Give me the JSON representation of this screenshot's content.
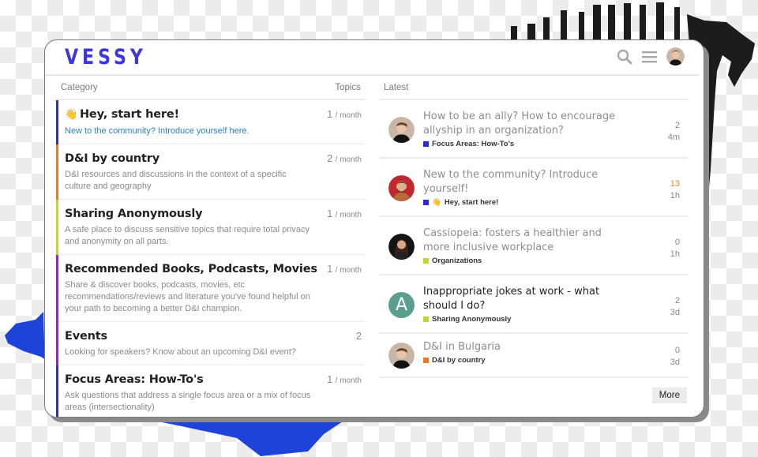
{
  "brand": {
    "logo": "VESSY",
    "accent": "#3d36d9"
  },
  "header": {
    "icons": [
      "search-icon",
      "hamburger-menu-icon",
      "user-avatar"
    ]
  },
  "categories": {
    "column_label": "Category",
    "topics_label": "Topics",
    "items": [
      {
        "emoji": "👋",
        "title": "Hey, start here!",
        "description": "New to the community? Introduce yourself here.",
        "count": "1",
        "period": "/ month",
        "color": "#2c2cd6",
        "desc_is_link": true
      },
      {
        "emoji": "",
        "title": "D&I by country",
        "description": "D&I resources and discussions in the context of a specific culture and geography",
        "count": "2",
        "period": "/ month",
        "color": "#f47620"
      },
      {
        "emoji": "",
        "title": "Sharing Anonymously",
        "description": "A safe place to discuss sensitive topics that require total privacy and anonymity on all parts.",
        "count": "1",
        "period": "/ month",
        "color": "#bfd831"
      },
      {
        "emoji": "",
        "title": "Recommended Books, Podcasts, Movies",
        "description": "Share & discover books, podcasts, movies, etc recommendations/reviews and literature you've found helpful on your path to becoming a better D&I champion.",
        "count": "1",
        "period": "/ month",
        "color": "#9b1fd8"
      },
      {
        "emoji": "",
        "title": "Events",
        "description": "Looking for speakers? Know about an upcoming D&I event?",
        "count": "2",
        "period": "",
        "color": "#9b1fd8"
      },
      {
        "emoji": "",
        "title": "Focus Areas: How-To's",
        "description": "Ask questions that address a single focus area or a mix of focus areas (intersectionality)",
        "count": "1",
        "period": "/ month",
        "color": "#2c2cd6"
      }
    ]
  },
  "latest": {
    "column_label": "Latest",
    "topics": [
      {
        "title": "How to be an ally? How to encourage allyship in an organization?",
        "category": "Focus Areas: How-To's",
        "category_emoji": "",
        "category_color": "#2c2cd6",
        "replies": "2",
        "age": "4m",
        "hot": false,
        "unread": false,
        "avatar": "photo-woman-short-hair"
      },
      {
        "title": "New to the community? Introduce yourself!",
        "category": "Hey, start here!",
        "category_emoji": "👋",
        "category_color": "#2c2cd6",
        "replies": "13",
        "age": "1h",
        "hot": true,
        "unread": false,
        "avatar": "photo-man-red-background"
      },
      {
        "title": "Cassiopeia: fosters a healthier and more inclusive workplace",
        "category": "Organizations",
        "category_emoji": "",
        "category_color": "#bfd831",
        "replies": "0",
        "age": "1h",
        "hot": false,
        "unread": false,
        "avatar": "photo-woman-long-hair"
      },
      {
        "title": "Inappropriate jokes at work - what should I do?",
        "category": "Sharing Anonymously",
        "category_emoji": "",
        "category_color": "#bfd831",
        "replies": "2",
        "age": "3d",
        "hot": false,
        "unread": true,
        "avatar": "letter-A",
        "avatar_letter": "A",
        "avatar_color": "#5a9e8f"
      },
      {
        "title": "D&I in Bulgaria",
        "category": "D&I by country",
        "category_emoji": "",
        "category_color": "#f47620",
        "replies": "0",
        "age": "3d",
        "hot": false,
        "unread": false,
        "avatar": "photo-woman-short-hair"
      }
    ],
    "more_label": "More"
  }
}
